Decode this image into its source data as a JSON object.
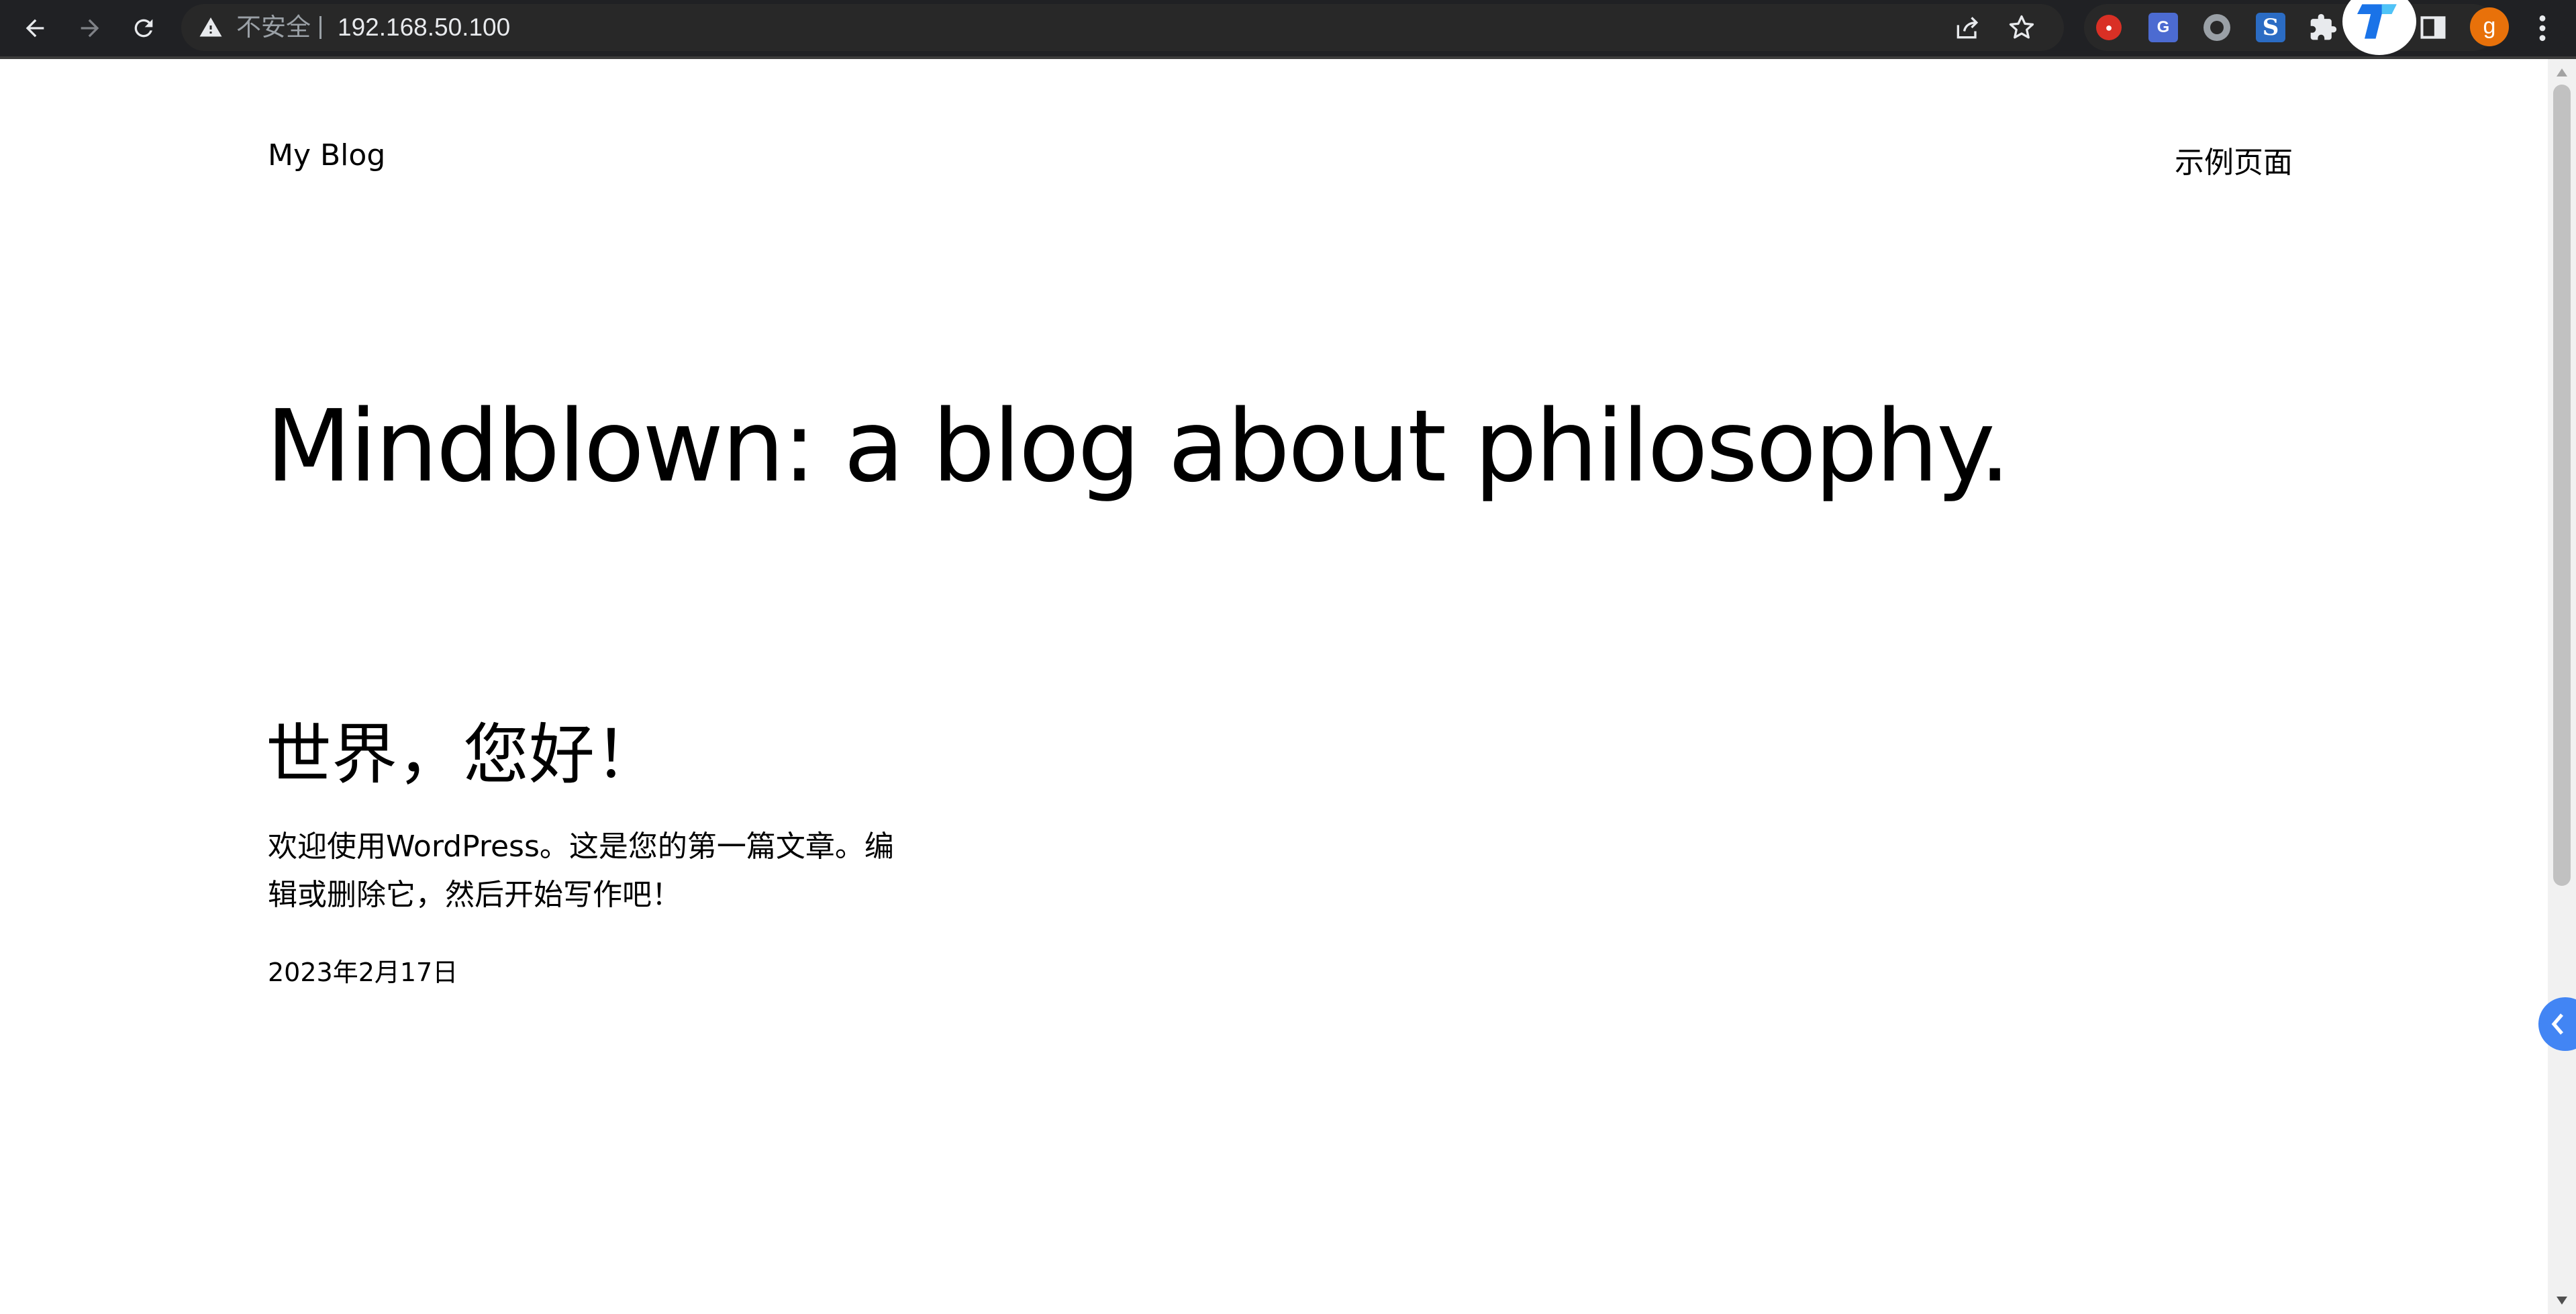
{
  "browser": {
    "security_label": "不安全",
    "url": "192.168.50.100",
    "profile_initial": "g",
    "icons": {
      "back": "back-arrow-icon",
      "forward": "forward-arrow-icon",
      "reload": "reload-icon",
      "warning": "warning-icon",
      "share": "share-icon",
      "bookmark": "star-icon",
      "extensions": "puzzle-icon",
      "side_panel": "side-panel-icon",
      "menu": "kebab-menu-icon"
    },
    "extension_badges": {
      "google_translate": "G",
      "s_extension": "S"
    },
    "colors": {
      "toolbar": "#202124",
      "omnibox": "#282828",
      "avatar": "#e8710a",
      "side_tab": "#4285f4"
    }
  },
  "site": {
    "title": "My Blog",
    "nav": [
      "示例页面"
    ],
    "tagline": "Mindblown: a blog about philosophy."
  },
  "posts": [
    {
      "title": "世界，您好！",
      "excerpt": "欢迎使用WordPress。这是您的第一篇文章。编辑或删除它，然后开始写作吧！",
      "date": "2023年2月17日"
    }
  ]
}
